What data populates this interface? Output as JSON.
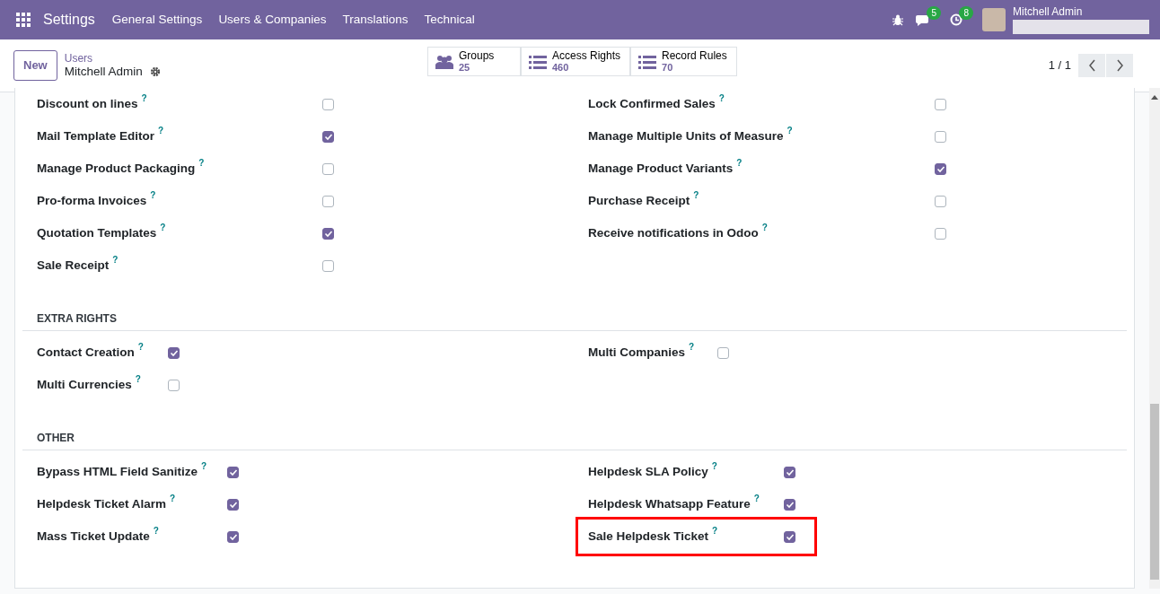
{
  "navbar": {
    "app": "Settings",
    "menus": [
      "General Settings",
      "Users & Companies",
      "Translations",
      "Technical"
    ],
    "messages_count": "5",
    "activities_count": "8",
    "user": "Mitchell Admin"
  },
  "control_panel": {
    "new_button": "New",
    "breadcrumb": "Users",
    "record": "Mitchell Admin",
    "smart_buttons": [
      {
        "kind": "groups",
        "label": "Groups",
        "value": "25"
      },
      {
        "kind": "list",
        "label": "Access Rights",
        "value": "460"
      },
      {
        "kind": "list",
        "label": "Record Rules",
        "value": "70"
      }
    ],
    "pager": "1 / 1"
  },
  "sections": [
    {
      "items": [
        {
          "label": "Discount on lines",
          "help": "?",
          "checked": false
        },
        {
          "label": "Lock Confirmed Sales",
          "help": "?",
          "checked": false
        },
        {
          "label": "Mail Template Editor",
          "help": "?",
          "checked": true
        },
        {
          "label": "Manage Multiple Units of Measure",
          "help": "?",
          "checked": false
        },
        {
          "label": "Manage Product Packaging",
          "help": "?",
          "checked": false
        },
        {
          "label": "Manage Product Variants",
          "help": "?",
          "checked": true
        },
        {
          "label": "Pro-forma Invoices",
          "help": "?",
          "checked": false
        },
        {
          "label": "Purchase Receipt",
          "help": "?",
          "checked": false
        },
        {
          "label": "Quotation Templates",
          "help": "?",
          "checked": true
        },
        {
          "label": "Receive notifications in Odoo",
          "help": "?",
          "checked": false
        },
        {
          "label": "Sale Receipt",
          "help": "?",
          "checked": false
        }
      ]
    },
    {
      "title": "EXTRA RIGHTS",
      "items": [
        {
          "label": "Contact Creation",
          "help": "?",
          "checked": true
        },
        {
          "label": "Multi Companies",
          "help": "?",
          "checked": false
        },
        {
          "label": "Multi Currencies",
          "help": "?",
          "checked": false
        }
      ]
    },
    {
      "title": "OTHER",
      "items": [
        {
          "label": "Bypass HTML Field Sanitize",
          "help": "?",
          "checked": true
        },
        {
          "label": "Helpdesk SLA Policy",
          "help": "?",
          "checked": true
        },
        {
          "label": "Helpdesk Ticket Alarm",
          "help": "?",
          "checked": true
        },
        {
          "label": "Helpdesk Whatsapp Feature",
          "help": "?",
          "checked": true
        },
        {
          "label": "Mass Ticket Update",
          "help": "?",
          "checked": true
        },
        {
          "label": "Sale Helpdesk Ticket",
          "help": "?",
          "checked": true,
          "highlighted": true
        }
      ]
    }
  ]
}
